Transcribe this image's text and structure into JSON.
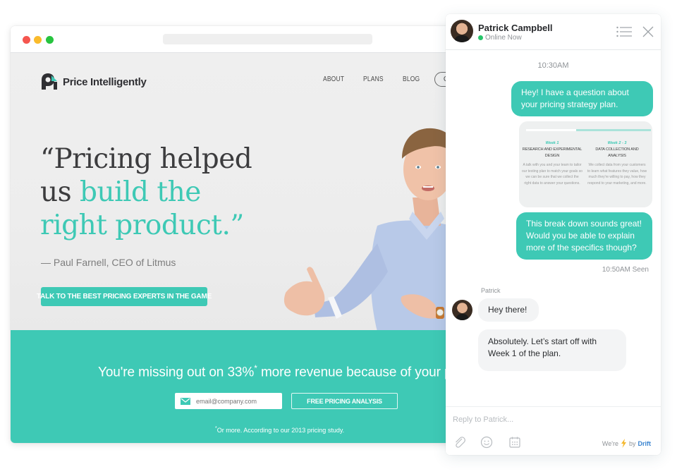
{
  "browser": {
    "window_controls": [
      "close",
      "minimize",
      "maximize"
    ]
  },
  "site": {
    "logo_text": "Price Intelligently",
    "nav": [
      {
        "label": "ABOUT"
      },
      {
        "label": "PLANS"
      },
      {
        "label": "BLOG"
      }
    ],
    "nav_cta": "GET IN",
    "quote": {
      "open": "“Pricing helped us ",
      "accent": "build the right product.”"
    },
    "attribution": "— Paul Farnell, CEO of Litmus",
    "hero_cta": "TALK TO THE BEST PRICING EXPERTS IN THE GAME",
    "carousel": {
      "count": 2,
      "active": 2
    },
    "band": {
      "headline_pre": "You're missing out on 33%",
      "headline_sup": "*",
      "headline_post": " more revenue because of your pr",
      "email_placeholder": "email@company.com",
      "email_icon": "envelope-icon",
      "button": "FREE PRICING ANALYSIS",
      "footnote_sup": "*",
      "footnote": "Or more. According to our 2013 pricing study."
    },
    "accent_color": "#3ec9b5"
  },
  "chat": {
    "agent_name": "Patrick Campbell",
    "status": "Online Now",
    "status_color": "#27c46a",
    "header_icons": [
      "menu-icon",
      "close-icon"
    ],
    "time_label": "10:30AM",
    "messages": [
      {
        "from": "visitor",
        "text": "Hey! I have a question about your pricing strategy plan."
      },
      {
        "from": "visitor",
        "text": "This break down sounds great! Would you be able to explain more of the specifics though?"
      },
      {
        "from": "agent",
        "text": "Hey there!"
      },
      {
        "from": "agent",
        "text": "Absolutely. Let’s start off with Week 1 of the plan."
      }
    ],
    "plan_card": {
      "progress_fraction": 0.4,
      "columns": [
        {
          "week": "Week 1",
          "title": "RESEARCH AND EXPERIMENTAL DESIGN",
          "description": "A talk with you and your team to tailor our testing plan to match your goals so we can be sure that we collect the right data to answer your questions."
        },
        {
          "week": "Week 2 - 3",
          "title": "DATA COLLECTION AND ANALYSIS",
          "description": "We collect data from your customers to learn what features they value, how much they're willing to pay, how they respond to your marketing, and more."
        }
      ]
    },
    "seen_label": "10:50AM Seen",
    "sender_label": "Patrick",
    "reply_placeholder": "Reply to Patrick...",
    "footer_icons": [
      "paperclip-icon",
      "emoji-icon",
      "calendar-icon"
    ],
    "powered_pre": "We're",
    "powered_by": "by",
    "powered_brand": "Drift"
  }
}
